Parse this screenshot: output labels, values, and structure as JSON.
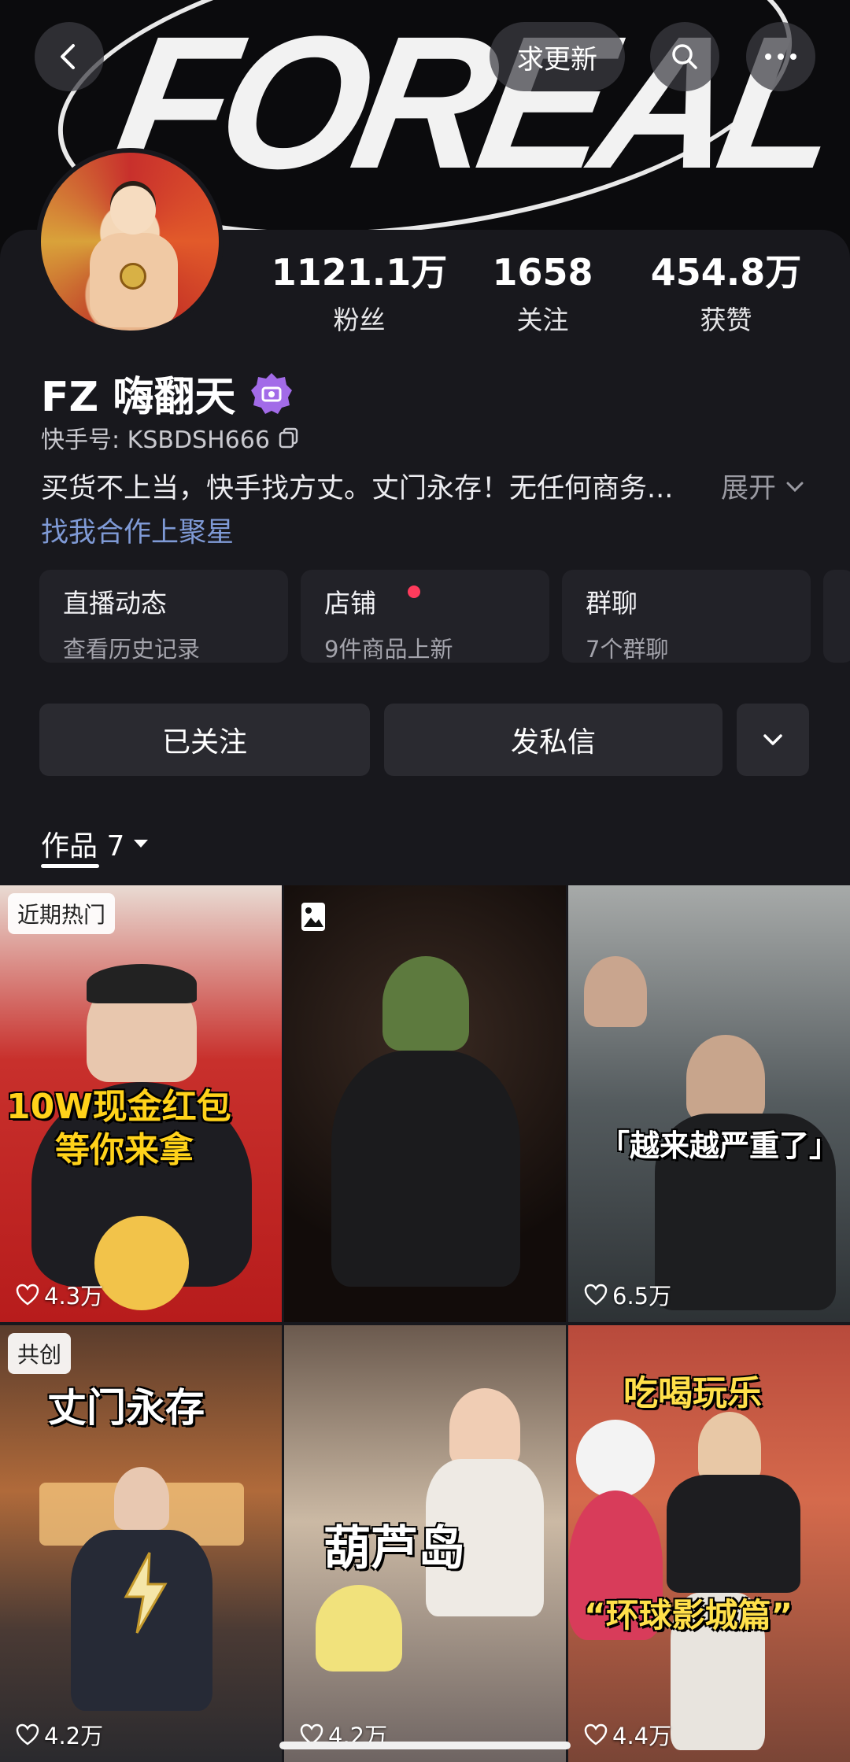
{
  "header": {
    "banner_text": "FOREAL",
    "update_label": "求更新"
  },
  "profile": {
    "stats": [
      {
        "value": "1121.1万",
        "label": "粉丝"
      },
      {
        "value": "1658",
        "label": "关注"
      },
      {
        "value": "454.8万",
        "label": "获赞"
      }
    ],
    "name": "FZ 嗨翻天",
    "kuaishou_id": "快手号: KSBDSH666",
    "bio": "买货不上当，快手找方丈。丈门永存！无任何商务...",
    "expand_label": "展开",
    "cooperation_link": "找我合作上聚星"
  },
  "entries": [
    {
      "title": "直播动态",
      "subtitle": "查看历史记录"
    },
    {
      "title": "店铺",
      "subtitle": "9件商品上新"
    },
    {
      "title": "群聊",
      "subtitle": "7个群聊"
    }
  ],
  "actions": {
    "follow_label": "已关注",
    "message_label": "发私信"
  },
  "tabs": {
    "works_label": "作品 7"
  },
  "grid": [
    {
      "badge": "近期热门",
      "likes": "4.3万",
      "overlay": "10W现金红包",
      "overlay2": "等你来拿"
    },
    {
      "badge": "",
      "likes": "",
      "overlay": "",
      "overlay2": ""
    },
    {
      "badge": "",
      "likes": "6.5万",
      "overlay": "「越来越严重了」",
      "overlay2": ""
    },
    {
      "badge": "共创",
      "likes": "4.2万",
      "overlay": "丈门永存",
      "overlay2": ""
    },
    {
      "badge": "",
      "likes": "4.2万",
      "overlay": "葫芦岛",
      "overlay2": ""
    },
    {
      "badge": "",
      "likes": "4.4万",
      "overlay": "吃喝玩乐",
      "overlay2": "“环球影城篇”"
    }
  ],
  "colors": {
    "background": "#141419",
    "card": "#18181d",
    "accent_link": "#7f9ad6",
    "verify_badge": "#a26be8",
    "notify_dot": "#ff3b5c"
  },
  "icons": [
    "back-icon",
    "search-icon",
    "more-icon",
    "verify-icon",
    "copy-icon",
    "chevron-down-icon",
    "triangle-down-icon",
    "heart-icon",
    "photo-icon"
  ]
}
